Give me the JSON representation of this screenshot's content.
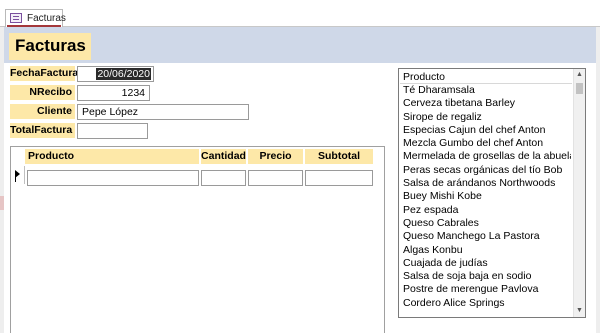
{
  "tab": {
    "label": "Facturas",
    "close_glyph": "×"
  },
  "header": {
    "title": "Facturas"
  },
  "fields": {
    "fecha_label": "FechaFactura",
    "fecha_value": "20/06/2020",
    "nrecibo_label": "NRecibo",
    "nrecibo_value": "1234",
    "cliente_label": "Cliente",
    "cliente_value": "Pepe López",
    "total_label": "TotalFactura",
    "total_value": ""
  },
  "subform": {
    "columns": [
      "Producto",
      "Cantidad",
      "Precio",
      "Subtotal"
    ]
  },
  "listbox": {
    "header": "Producto",
    "items": [
      "Té Dharamsala",
      "Cerveza tibetana Barley",
      "Sirope de regaliz",
      "Especias Cajun del chef Anton",
      "Mezcla Gumbo del chef Anton",
      "Mermelada de grosellas de la abuela",
      "Peras secas orgánicas del tío Bob",
      "Salsa de arándanos Northwoods",
      "Buey Mishi Kobe",
      "Pez espada",
      "Queso Cabrales",
      "Queso Manchego La Pastora",
      "Algas Konbu",
      "Cuajada de judías",
      "Salsa de soja baja en sodio",
      "Postre de merengue Pavlova",
      "Cordero Alice Springs"
    ]
  },
  "colors": {
    "label_bg": "#fde8a8",
    "header_bg": "#cfd8e8",
    "tab_accent": "#a4373a"
  },
  "icons": {
    "tab": "form-icon",
    "scroll_up": "▲",
    "scroll_down": "▼"
  }
}
